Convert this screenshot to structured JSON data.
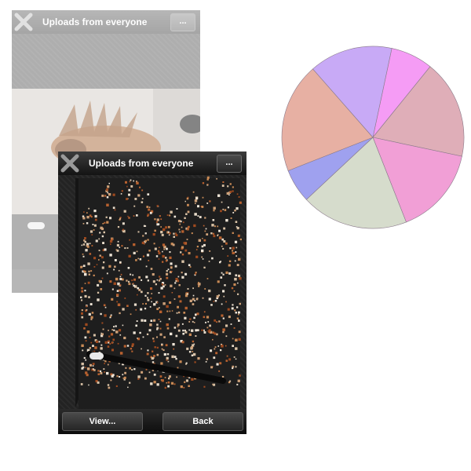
{
  "back_window": {
    "title": "Uploads from everyone",
    "menu_label": "...",
    "close_icon": "close-icon"
  },
  "front_window": {
    "title": "Uploads from everyone",
    "menu_label": "...",
    "close_icon": "close-icon",
    "buttons": {
      "view_label": "View...",
      "back_label": "Back"
    }
  },
  "chart_data": {
    "type": "pie",
    "title": "",
    "slices": [
      {
        "value": 0.075,
        "color": "#f59cf5"
      },
      {
        "value": 0.175,
        "color": "#dfaeb8"
      },
      {
        "value": 0.157,
        "color": "#f19fd6"
      },
      {
        "value": 0.19,
        "color": "#d6dccc"
      },
      {
        "value": 0.06,
        "color": "#9fa1ef"
      },
      {
        "value": 0.195,
        "color": "#e7b0a3"
      },
      {
        "value": 0.148,
        "color": "#c8aaf6"
      }
    ]
  }
}
